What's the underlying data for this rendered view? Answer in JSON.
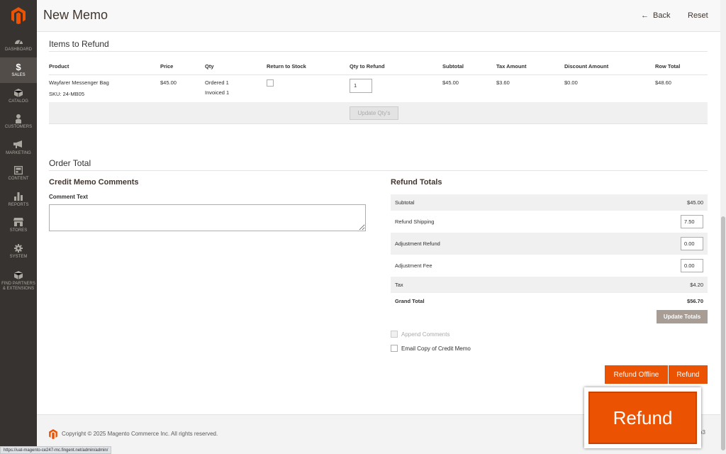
{
  "sidebar": {
    "items": [
      {
        "label": "DASHBOARD",
        "icon": "gauge-icon"
      },
      {
        "label": "SALES",
        "icon": "dollar-icon",
        "active": true
      },
      {
        "label": "CATALOG",
        "icon": "cube-icon"
      },
      {
        "label": "CUSTOMERS",
        "icon": "person-icon"
      },
      {
        "label": "MARKETING",
        "icon": "megaphone-icon"
      },
      {
        "label": "CONTENT",
        "icon": "layout-icon"
      },
      {
        "label": "REPORTS",
        "icon": "bar-chart-icon"
      },
      {
        "label": "STORES",
        "icon": "store-icon"
      },
      {
        "label": "SYSTEM",
        "icon": "gear-icon"
      },
      {
        "label": "FIND PARTNERS\n& EXTENSIONS",
        "icon": "box-icon"
      }
    ]
  },
  "header": {
    "title": "New Memo",
    "back_label": "Back",
    "reset_label": "Reset"
  },
  "items_section": {
    "title": "Items to Refund",
    "columns": [
      "Product",
      "Price",
      "Qty",
      "Return to Stock",
      "Qty to Refund",
      "Subtotal",
      "Tax Amount",
      "Discount Amount",
      "Row Total"
    ],
    "row": {
      "product": "Wayfarer Messenger Bag",
      "sku": "SKU: 24-MB05",
      "price": "$45.00",
      "qty_ordered": "Ordered 1",
      "qty_invoiced": "Invoiced 1",
      "qty_to_refund": "1",
      "subtotal": "$45.00",
      "tax": "$3.60",
      "discount": "$0.00",
      "row_total": "$48.60"
    },
    "update_qty_label": "Update Qty's"
  },
  "order_total": {
    "title": "Order Total",
    "comments_title": "Credit Memo Comments",
    "comment_label": "Comment Text",
    "refund_totals_title": "Refund Totals",
    "subtotal_label": "Subtotal",
    "subtotal_value": "$45.00",
    "refund_shipping_label": "Refund Shipping",
    "refund_shipping_value": "7.50",
    "adjustment_refund_label": "Adjustment Refund",
    "adjustment_refund_value": "0.00",
    "adjustment_fee_label": "Adjustment Fee",
    "adjustment_fee_value": "0.00",
    "tax_label": "Tax",
    "tax_value": "$4.20",
    "grand_total_label": "Grand Total",
    "grand_total_value": "$56.70",
    "update_totals_label": "Update Totals",
    "append_comments_label": "Append Comments",
    "email_copy_label": "Email Copy of Credit Memo",
    "refund_offline_label": "Refund Offline",
    "refund_label": "Refund",
    "callout_label": "Refund"
  },
  "footer": {
    "copyright": "Copyright © 2025 Magento Commerce Inc. All rights reserved.",
    "version_fragment": "o3"
  },
  "status_url": "https://uat-magento-ce247-mc.fingent.net/admin/admin/",
  "colors": {
    "accent": "#eb5202",
    "sidebar": "#373330"
  }
}
